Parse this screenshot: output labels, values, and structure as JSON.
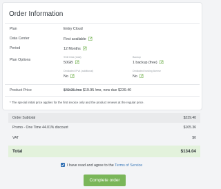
{
  "order_info": {
    "title": "Order Information",
    "rows": {
      "plan": {
        "label": "Plan",
        "value": "Entry Cloud"
      },
      "data_center": {
        "label": "Data Center",
        "value": "First available"
      },
      "period": {
        "label": "Period",
        "value": "12 Months"
      },
      "plan_options": {
        "label": "Plan Options"
      }
    },
    "options": {
      "ssd_disk": {
        "label": "SSD Disk (total)",
        "value": "50GB"
      },
      "backup": {
        "label": "Backup",
        "value": "1 backup (free)"
      },
      "dedicated_ip": {
        "label": "Dedicated IPv4 (additional)",
        "value": "No"
      },
      "license": {
        "label": "Dedicated hosting license",
        "value": "No"
      }
    },
    "product_price": {
      "label": "Product Price",
      "old_price": "$49.95 /mo",
      "new_price": "$19.95 /mo",
      "due_text": ", now due $239.40"
    },
    "footnote": "* The special initial price applies for the first invoice only and the product renews at the regular price."
  },
  "summary": {
    "order_subtotal": {
      "label": "Order Subtotal",
      "value": "$239.40"
    },
    "promo": {
      "label": "Promo - One Time 44.01% discount",
      "value": "$105.36"
    },
    "vat": {
      "label": "VAT",
      "value": "$0"
    },
    "total": {
      "label": "Total",
      "value": "$134.04"
    }
  },
  "agreement": {
    "text": "I have read and agree to the ",
    "link": "Terms of Service"
  },
  "complete_button": "Complete order",
  "colors": {
    "accent_green": "#7ab659",
    "edit_icon_green": "#7ab659",
    "link_blue": "#3a78b8",
    "total_row_bg": "#e3f2dc"
  },
  "icons": {
    "edit": "edit-pencil-icon",
    "checkbox": "checkbox-checked-icon"
  }
}
